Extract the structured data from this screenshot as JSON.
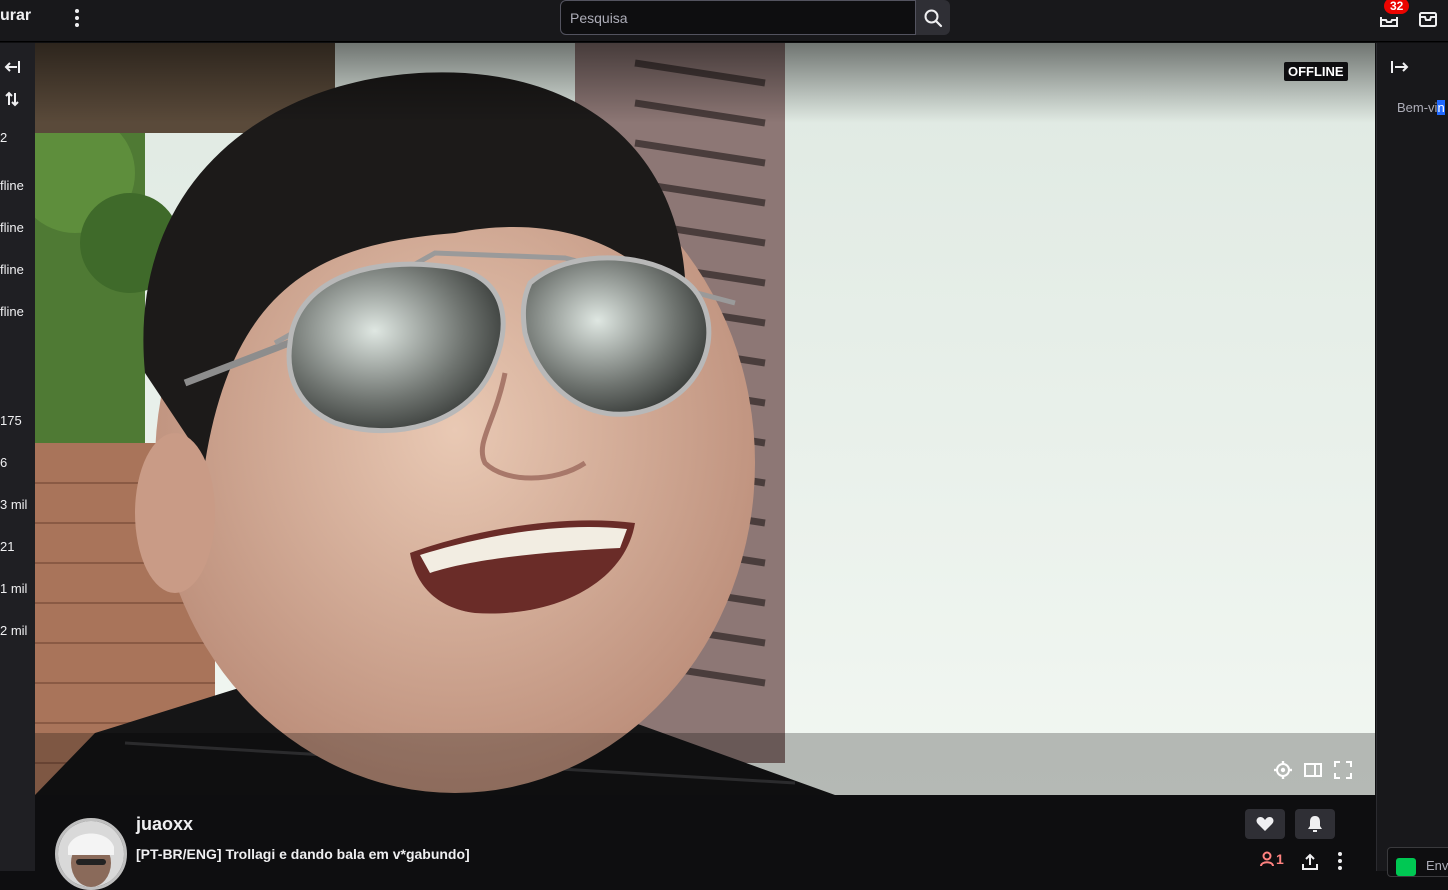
{
  "topbar": {
    "brand_text": "urar",
    "search": {
      "placeholder": "Pesquisa",
      "value": ""
    },
    "notifications": {
      "count": "32"
    }
  },
  "left_sidebar": {
    "items": [
      {
        "text": "2"
      },
      {
        "text": "fline"
      },
      {
        "text": "fline"
      },
      {
        "text": "fline"
      },
      {
        "text": "fline"
      },
      {
        "text": "175"
      },
      {
        "text": "6"
      },
      {
        "text": "3 mil"
      },
      {
        "text": "21"
      },
      {
        "text": "1 mil"
      },
      {
        "text": "2 mil"
      }
    ]
  },
  "player": {
    "status_badge": "OFFLINE"
  },
  "channel": {
    "name": "juaoxx",
    "title": "[PT-BR/ENG] Trollagi e dando bala em v*gabundo]",
    "viewers": "1"
  },
  "chat": {
    "welcome_text": "Bem-vi",
    "welcome_highlight": "n",
    "send_label": "Env"
  },
  "colors": {
    "accent": "#9147ff",
    "badge_red": "#eb0400",
    "highlight_blue": "#1f69ff",
    "viewer_red": "#ff8280"
  }
}
